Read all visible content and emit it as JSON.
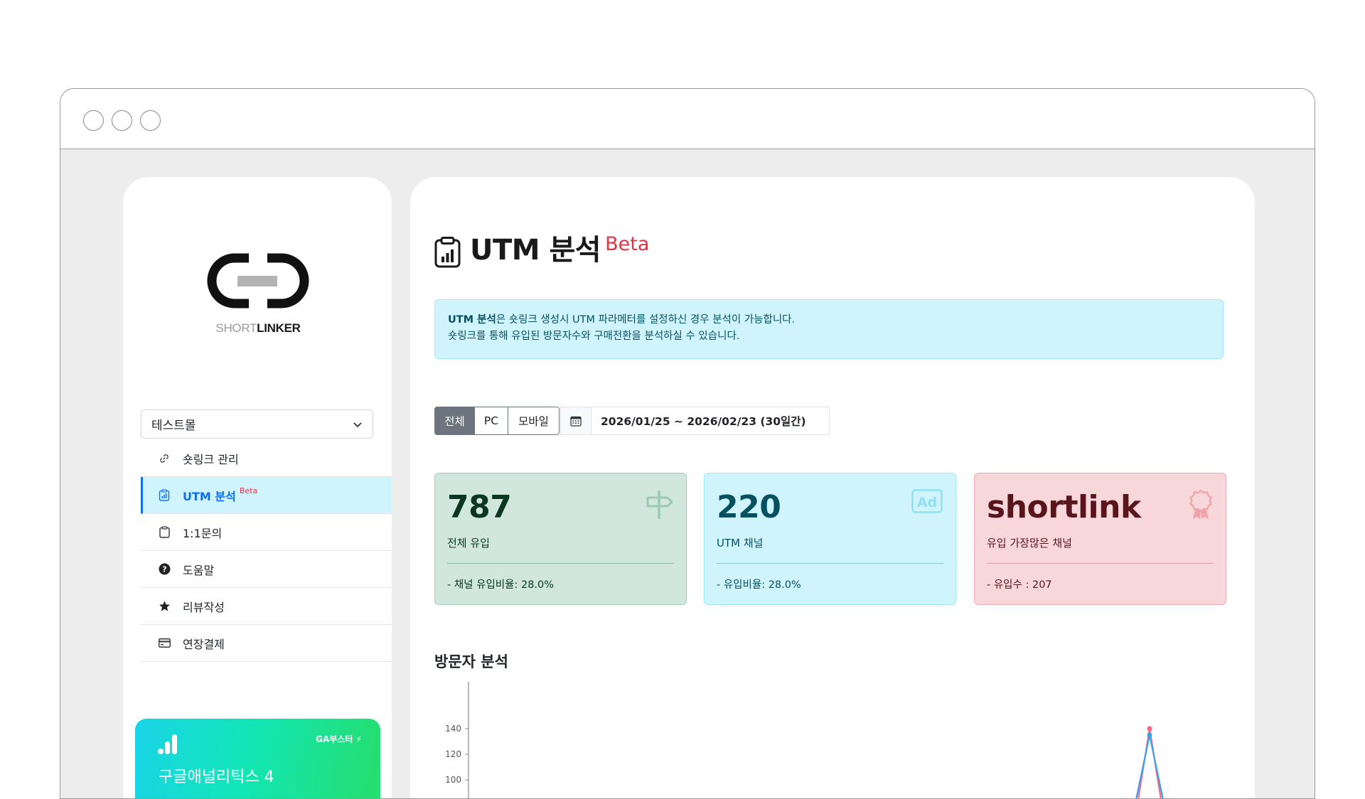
{
  "sidebar": {
    "logo": {
      "text_light": "SHORT",
      "text_bold": "LINKER"
    },
    "shop_select": {
      "value": "테스트몰"
    },
    "items": [
      {
        "label": "숏링크 관리",
        "icon": "link-icon"
      },
      {
        "label": "UTM 분석",
        "icon": "clipboard-chart-icon",
        "badge": "Beta",
        "active": true
      },
      {
        "label": "1:1문의",
        "icon": "clipboard-icon"
      },
      {
        "label": "도움말",
        "icon": "question-circle-icon"
      },
      {
        "label": "리뷰작성",
        "icon": "star-icon"
      },
      {
        "label": "연장결제",
        "icon": "credit-card-icon"
      }
    ],
    "promo": {
      "badge": "GA부스터",
      "title": "구글애널리틱스 4"
    }
  },
  "main": {
    "title": "UTM 분석",
    "title_badge": "Beta",
    "info": {
      "line1_bold": "UTM 분석",
      "line1_rest": "은 숏링크 생성시 UTM 파라메터를 설정하신 경우 분석이 가능합니다.",
      "line2": "숏링크를 통해 유입된 방문자수와 구매전환을 분석하실 수 있습니다."
    },
    "filters": {
      "segments": [
        "전체",
        "PC",
        "모바일"
      ],
      "active_segment": "전체",
      "date_range": "2026/01/25 ~ 2026/02/23 (30일간)"
    },
    "cards": [
      {
        "value": "787",
        "label": "전체 유입",
        "footer": "- 채널 유입비율: 28.0%",
        "icon": "signpost-icon"
      },
      {
        "value": "220",
        "label": "UTM 채널",
        "footer": "- 유입비율: 28.0%",
        "icon": "ad-icon"
      },
      {
        "value": "shortlink",
        "label": "유입 가장많은 채널",
        "footer": "- 유입수 : 207",
        "icon": "award-icon"
      }
    ],
    "section_title": "방문자 분석"
  },
  "chart_data": {
    "type": "line",
    "y_ticks": [
      "140",
      "120",
      "100"
    ],
    "ylim": [
      80,
      150
    ],
    "series": [
      {
        "color": "#ff6384",
        "peak": 140
      },
      {
        "color": "#36a2eb",
        "peak": 135
      }
    ]
  },
  "colors": {
    "primary": "#0d6efd",
    "info_bg": "#cff4fc",
    "success_bg": "#d1e7dd",
    "danger_bg": "#f8d7da",
    "beta": "#dc3545"
  }
}
